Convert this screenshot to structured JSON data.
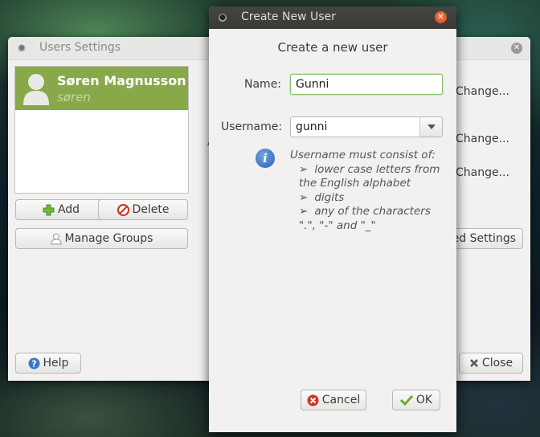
{
  "users_window": {
    "title": "Users Settings",
    "user": {
      "full_name": "Søren Magnusson",
      "login": "søren"
    },
    "buttons": {
      "add": "Add",
      "delete": "Delete",
      "manage_groups": "Manage Groups",
      "help": "Help",
      "close": "Close",
      "advanced": "ed Settings"
    },
    "change_links": [
      "Change...",
      "Change...",
      "Change..."
    ],
    "partial_label": "A"
  },
  "dialog": {
    "title": "Create New User",
    "heading": "Create a new user",
    "name_label": "Name:",
    "name_value": "Gunni",
    "username_label": "Username:",
    "username_value": "gunni",
    "hint": {
      "intro": "Username must consist of:",
      "items": [
        "lower case letters from the English alphabet",
        "digits",
        "any of the characters \".\", \"-\" and \"_\""
      ]
    },
    "cancel_label": "Cancel",
    "ok_label": "OK"
  },
  "colors": {
    "selection": "#88a84a",
    "focus": "#8ec072",
    "dialog_titlebar": "#3f3f3c",
    "close_red": "#e35a2c"
  },
  "icons": [
    "avatar-icon",
    "add-icon",
    "delete-icon",
    "group-icon",
    "help-icon",
    "close-x-icon",
    "info-icon",
    "cancel-icon",
    "ok-check-icon",
    "dropdown-arrow-icon"
  ]
}
